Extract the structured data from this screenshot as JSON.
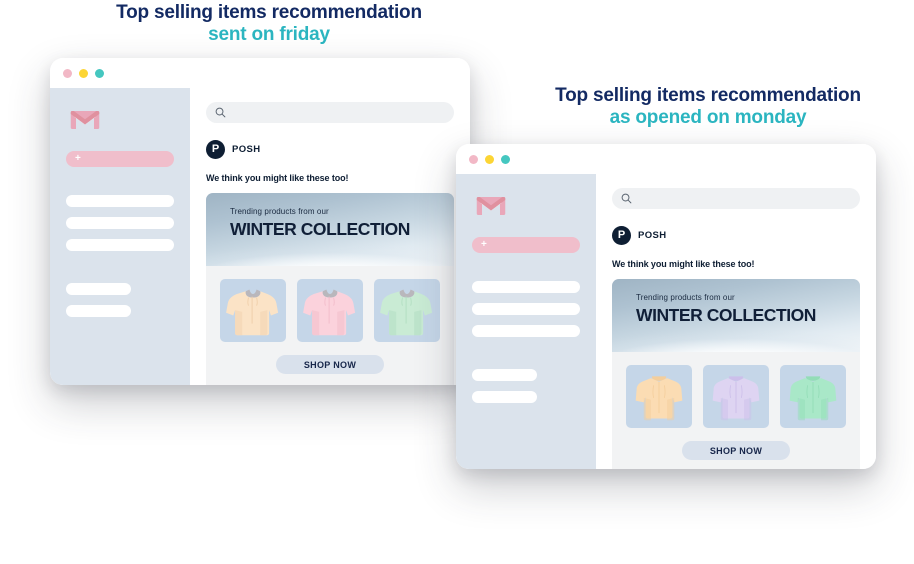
{
  "captions": {
    "friday": {
      "line1": "Top selling items recommendation",
      "line2": "sent on friday"
    },
    "monday": {
      "line1": "Top selling items recommendation",
      "line2": "as opened on monday"
    }
  },
  "colors": {
    "caption_primary": "#132A63",
    "caption_accent": "#2BB5C0",
    "traffic_pink": "#F2B8C6",
    "traffic_yellow": "#FCD535",
    "traffic_teal": "#45C7C0",
    "sidebar_bg": "#DBE3EC",
    "compose_pink": "#F0BECB",
    "avatar_navy": "#0E1E33",
    "product_tile": "#C5D6E8",
    "shop_button": "#D9E1EC"
  },
  "windows": [
    {
      "id": "friday",
      "traffic_lights": [
        "pink",
        "yellow",
        "teal"
      ],
      "sidebar": {
        "logo": "gmail-logo",
        "compose_label": "+",
        "nav_items": [
          {
            "width": "long"
          },
          {
            "width": "long"
          },
          {
            "width": "long"
          },
          {
            "width": "short"
          },
          {
            "width": "short"
          }
        ]
      },
      "mail": {
        "search_placeholder": "",
        "search_icon": "search-icon",
        "sender_initial": "P",
        "sender_name": "POSH",
        "preheader": "We think you might like these too!",
        "banner": {
          "subtitle": "Trending products from our",
          "title": "WINTER COLLECTION"
        },
        "products": [
          {
            "type": "hoodie",
            "color": "#FBE3C6",
            "shade": "#F3D4B0",
            "name": "peach-hoodie"
          },
          {
            "type": "hoodie",
            "color": "#FBD2DC",
            "shade": "#F2BDCB",
            "name": "pink-hoodie"
          },
          {
            "type": "hoodie",
            "color": "#C9EBD4",
            "shade": "#B3DFC2",
            "name": "mint-hoodie"
          }
        ],
        "cta_label": "SHOP NOW"
      }
    },
    {
      "id": "monday",
      "traffic_lights": [
        "pink",
        "yellow",
        "teal"
      ],
      "sidebar": {
        "logo": "gmail-logo",
        "compose_label": "+",
        "nav_items": [
          {
            "width": "long"
          },
          {
            "width": "long"
          },
          {
            "width": "long"
          },
          {
            "width": "short"
          },
          {
            "width": "short"
          }
        ]
      },
      "mail": {
        "search_placeholder": "",
        "search_icon": "search-icon",
        "sender_initial": "P",
        "sender_name": "POSH",
        "preheader": "We think you might like these too!",
        "banner": {
          "subtitle": "Trending products from our",
          "title": "WINTER COLLECTION"
        },
        "products": [
          {
            "type": "sweater",
            "color": "#FBDCB3",
            "shade": "#F4CE9C",
            "name": "orange-sweater"
          },
          {
            "type": "sweater",
            "color": "#DED4F2",
            "shade": "#CCBFEA",
            "name": "lavender-sweater"
          },
          {
            "type": "sweater",
            "color": "#A9E8C8",
            "shade": "#93DDB7",
            "name": "mint-sweater"
          }
        ],
        "cta_label": "SHOP NOW"
      }
    }
  ]
}
